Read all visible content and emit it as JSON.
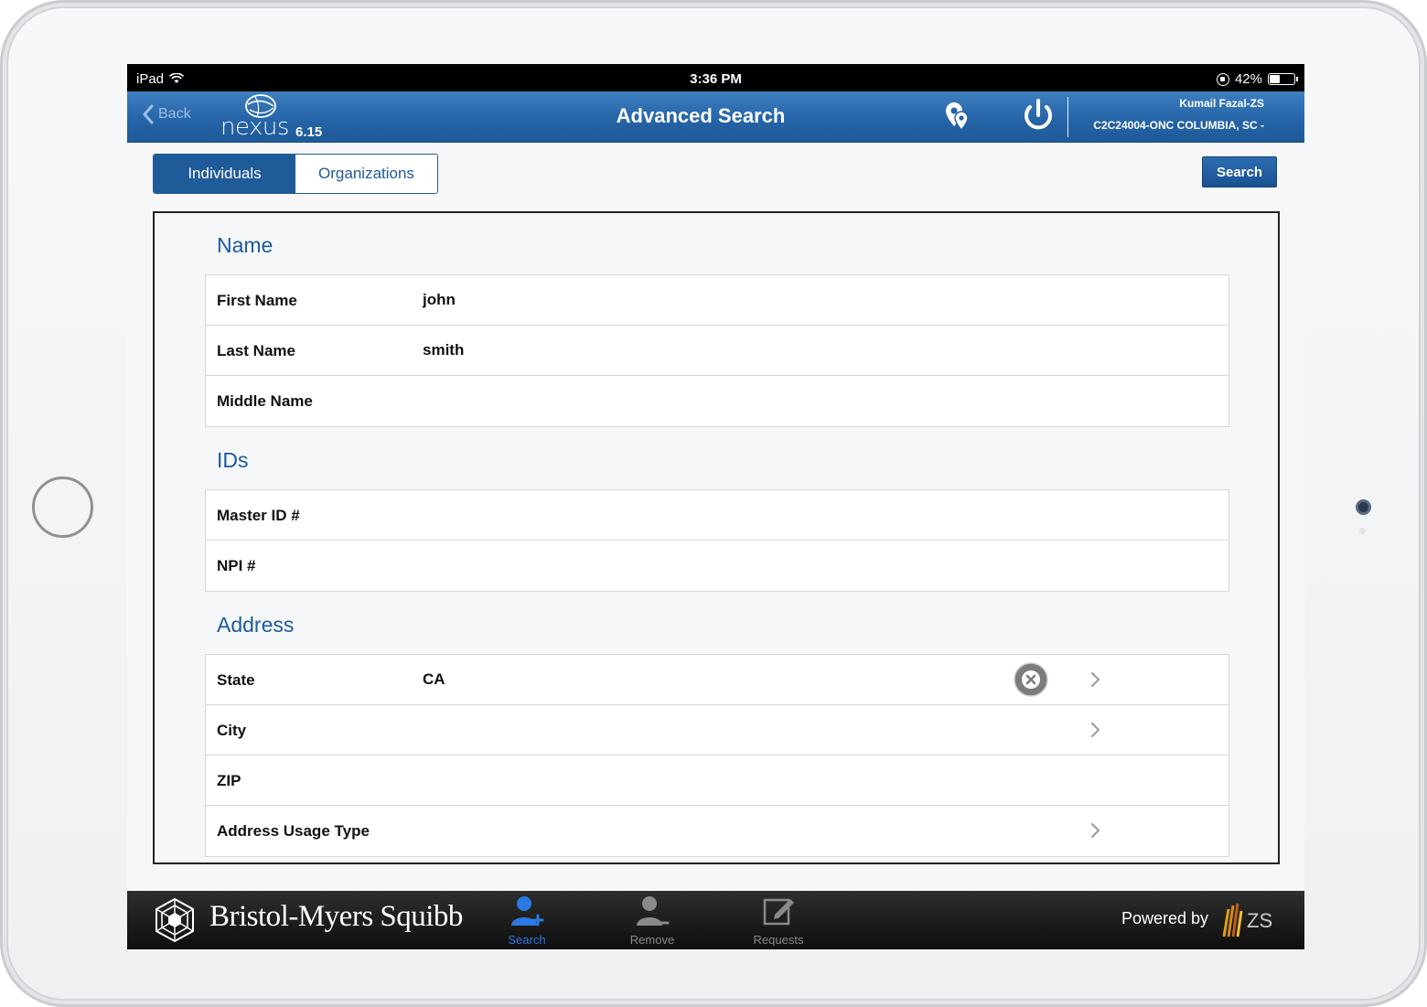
{
  "status_bar": {
    "device": "iPad",
    "time": "3:36 PM",
    "battery": "42%"
  },
  "nav": {
    "back_label": "Back",
    "app_name": "nexus",
    "app_version": "6.15",
    "title": "Advanced Search",
    "user_name": "Kumail Fazal-ZS",
    "user_territory": "C2C24004-ONC COLUMBIA, SC -"
  },
  "toolbar": {
    "segments": [
      {
        "label": "Individuals",
        "active": true
      },
      {
        "label": "Organizations",
        "active": false
      }
    ],
    "search_label": "Search"
  },
  "form": {
    "name_section": {
      "title": "Name",
      "rows": [
        {
          "label": "First Name",
          "value": "john"
        },
        {
          "label": "Last Name",
          "value": "smith"
        },
        {
          "label": "Middle Name",
          "value": ""
        }
      ]
    },
    "ids_section": {
      "title": "IDs",
      "rows": [
        {
          "label": "Master ID #",
          "value": ""
        },
        {
          "label": "NPI #",
          "value": ""
        }
      ]
    },
    "address_section": {
      "title": "Address",
      "rows": [
        {
          "label": "State",
          "value": "CA"
        },
        {
          "label": "City",
          "value": ""
        },
        {
          "label": "ZIP",
          "value": ""
        },
        {
          "label": "Address Usage Type",
          "value": ""
        }
      ]
    }
  },
  "tab_bar": {
    "brand": "Bristol-Myers Squibb",
    "tabs": [
      {
        "label": "Search",
        "active": true,
        "icon": "add-user-icon"
      },
      {
        "label": "Remove",
        "active": false,
        "icon": "remove-user-icon"
      },
      {
        "label": "Requests",
        "active": false,
        "icon": "edit-icon"
      }
    ],
    "powered_by": "Powered by",
    "vendor": "ZS"
  },
  "colors": {
    "nav_blue": "#2463a6",
    "accent": "#1f5a99",
    "section_title": "#1c5aa0",
    "tab_active": "#2a7ae2",
    "tab_inactive": "#8a8a8a"
  }
}
